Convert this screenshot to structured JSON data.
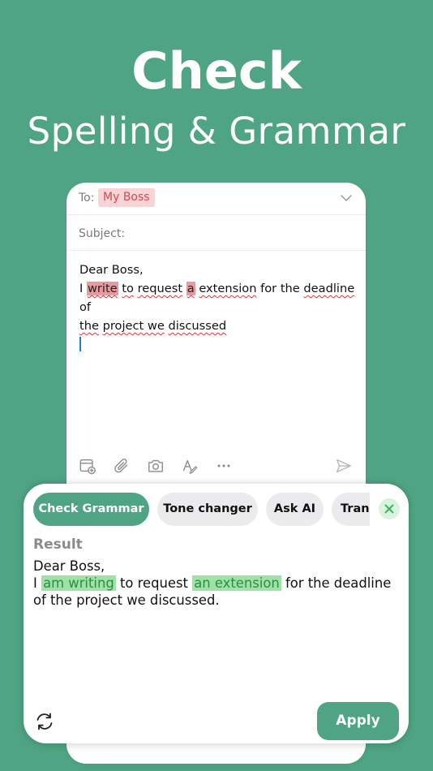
{
  "hero": {
    "title": "Check",
    "subtitle": "Spelling & Grammar"
  },
  "compose": {
    "to_label": "To:",
    "to_recipient": "My Boss",
    "subject_label": "Subject:",
    "body": {
      "greeting": "Dear Boss,",
      "l1_a": "I",
      "l1_err1": "write",
      "l1_b": "to",
      "l1_c": "request",
      "l1_err2": "a",
      "l1_d": "extension",
      "l1_e": "for the",
      "l1_f": "deadline",
      "l1_g": "of",
      "l2_a": "the",
      "l2_b": "project we",
      "l2_c": "discussed"
    },
    "toolbar_icons": [
      "calendar-add-icon",
      "paperclip-icon",
      "camera-icon",
      "handwriting-icon",
      "more-icon",
      "send-icon"
    ]
  },
  "grammar_panel": {
    "chips": [
      {
        "label": "Check Grammar",
        "active": true
      },
      {
        "label": "Tone changer",
        "active": false
      },
      {
        "label": "Ask AI",
        "active": false
      },
      {
        "label": "Translate",
        "active": false
      }
    ],
    "result_label": "Result",
    "result": {
      "greeting": "Dear Boss,",
      "a": "I",
      "fix1": "am writing",
      "b": "to request",
      "fix2": "an extension",
      "c": "for the deadline of the project we discussed."
    },
    "apply_label": "Apply"
  },
  "colors": {
    "brand_green": "#4FA583",
    "error_red": "#E0383E",
    "error_highlight": "#E89A9C",
    "fix_highlight": "#9EE3A6",
    "chip_idle": "#EBEBED"
  }
}
